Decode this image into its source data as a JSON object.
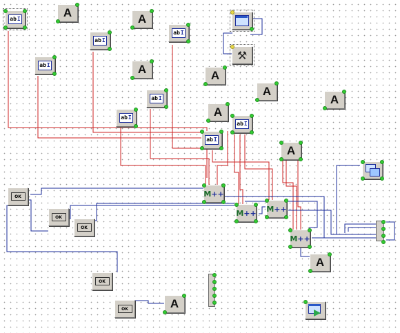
{
  "canvas": {
    "description_labels": {
      "edit_text": "ab",
      "static_text": "A",
      "button_text": "OK",
      "calc_text": "++"
    }
  },
  "colors": {
    "wire_red": "#cc2222",
    "wire_blue": "#1a2b9a",
    "pin_green": "#33cc33",
    "node_face": "#d4d0c8"
  },
  "icons": {
    "edit": "edit-field-icon",
    "label": "static-text-icon",
    "button": "push-button-icon",
    "form": "form-window-icon",
    "tools": "tools-icon",
    "calc": "calculator-icon",
    "group": "multi-window-icon",
    "bus": "bus-connector-icon",
    "export": "export-window-icon"
  }
}
